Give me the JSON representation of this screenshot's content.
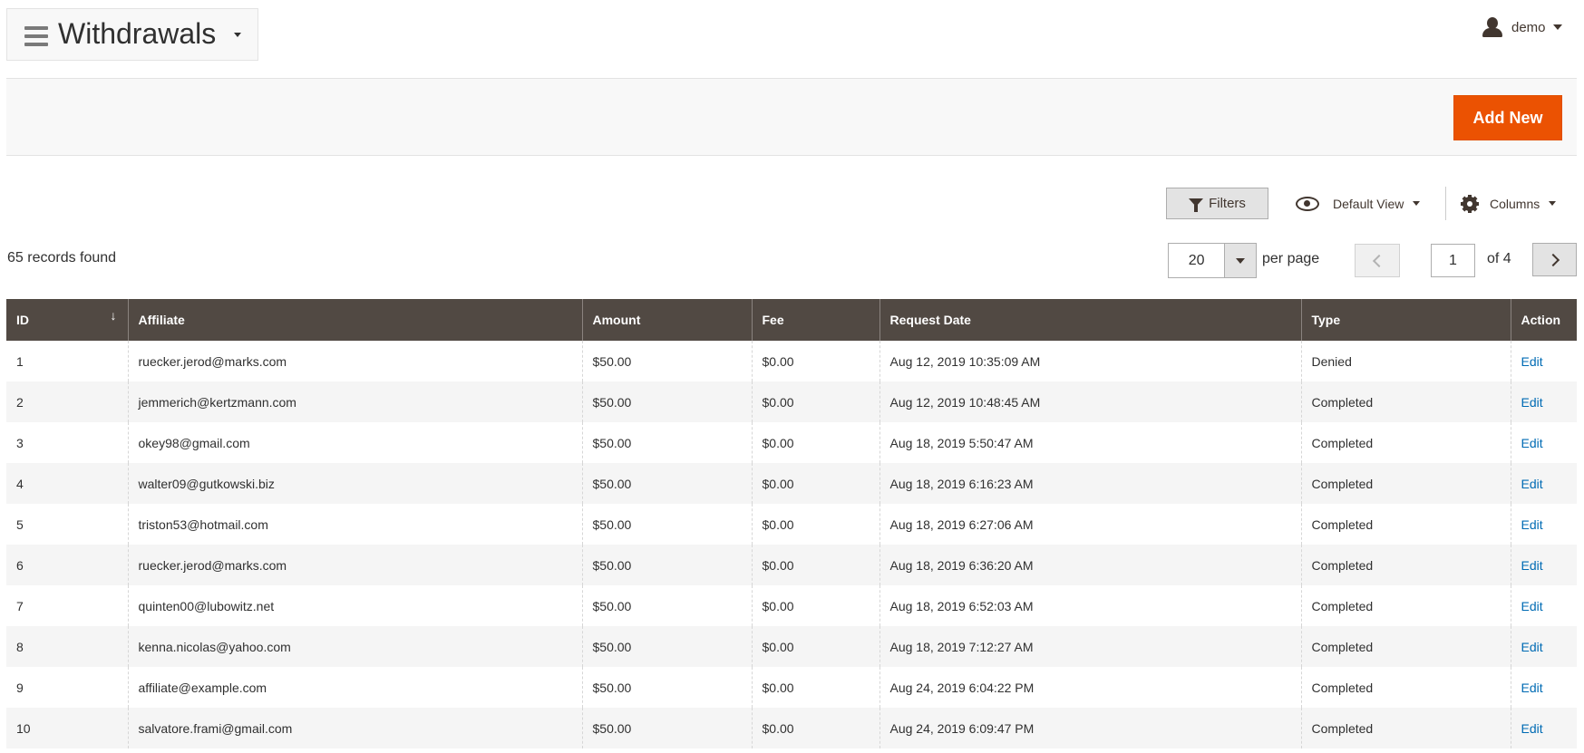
{
  "header": {
    "title": "Withdrawals",
    "user": "demo"
  },
  "action_bar": {
    "add_new_label": "Add New"
  },
  "controls": {
    "filters_label": "Filters",
    "view_label": "Default View",
    "columns_label": "Columns"
  },
  "pagination": {
    "records_found": "65 records found",
    "per_page_value": "20",
    "per_page_label": "per page",
    "current_page": "1",
    "of_label": "of 4"
  },
  "table": {
    "sort_indicator": "↓",
    "columns": [
      "ID",
      "Affiliate",
      "Amount",
      "Fee",
      "Request Date",
      "Type",
      "Action"
    ],
    "rows": [
      {
        "id": "1",
        "affiliate": "ruecker.jerod@marks.com",
        "amount": "$50.00",
        "fee": "$0.00",
        "date": "Aug 12, 2019 10:35:09 AM",
        "type": "Denied",
        "action": "Edit"
      },
      {
        "id": "2",
        "affiliate": "jemmerich@kertzmann.com",
        "amount": "$50.00",
        "fee": "$0.00",
        "date": "Aug 12, 2019 10:48:45 AM",
        "type": "Completed",
        "action": "Edit"
      },
      {
        "id": "3",
        "affiliate": "okey98@gmail.com",
        "amount": "$50.00",
        "fee": "$0.00",
        "date": "Aug 18, 2019 5:50:47 AM",
        "type": "Completed",
        "action": "Edit"
      },
      {
        "id": "4",
        "affiliate": "walter09@gutkowski.biz",
        "amount": "$50.00",
        "fee": "$0.00",
        "date": "Aug 18, 2019 6:16:23 AM",
        "type": "Completed",
        "action": "Edit"
      },
      {
        "id": "5",
        "affiliate": "triston53@hotmail.com",
        "amount": "$50.00",
        "fee": "$0.00",
        "date": "Aug 18, 2019 6:27:06 AM",
        "type": "Completed",
        "action": "Edit"
      },
      {
        "id": "6",
        "affiliate": "ruecker.jerod@marks.com",
        "amount": "$50.00",
        "fee": "$0.00",
        "date": "Aug 18, 2019 6:36:20 AM",
        "type": "Completed",
        "action": "Edit"
      },
      {
        "id": "7",
        "affiliate": "quinten00@lubowitz.net",
        "amount": "$50.00",
        "fee": "$0.00",
        "date": "Aug 18, 2019 6:52:03 AM",
        "type": "Completed",
        "action": "Edit"
      },
      {
        "id": "8",
        "affiliate": "kenna.nicolas@yahoo.com",
        "amount": "$50.00",
        "fee": "$0.00",
        "date": "Aug 18, 2019 7:12:27 AM",
        "type": "Completed",
        "action": "Edit"
      },
      {
        "id": "9",
        "affiliate": "affiliate@example.com",
        "amount": "$50.00",
        "fee": "$0.00",
        "date": "Aug 24, 2019 6:04:22 PM",
        "type": "Completed",
        "action": "Edit"
      },
      {
        "id": "10",
        "affiliate": "salvatore.frami@gmail.com",
        "amount": "$50.00",
        "fee": "$0.00",
        "date": "Aug 24, 2019 6:09:47 PM",
        "type": "Completed",
        "action": "Edit"
      }
    ]
  },
  "colors": {
    "accent": "#eb5202",
    "header_bg": "#514943",
    "link": "#006bb4"
  },
  "icons": [
    "menu-icon",
    "caret-down-icon",
    "user-icon",
    "filter-icon",
    "eye-icon",
    "gear-icon",
    "chevron-left-icon",
    "chevron-right-icon",
    "sort-down-icon"
  ]
}
